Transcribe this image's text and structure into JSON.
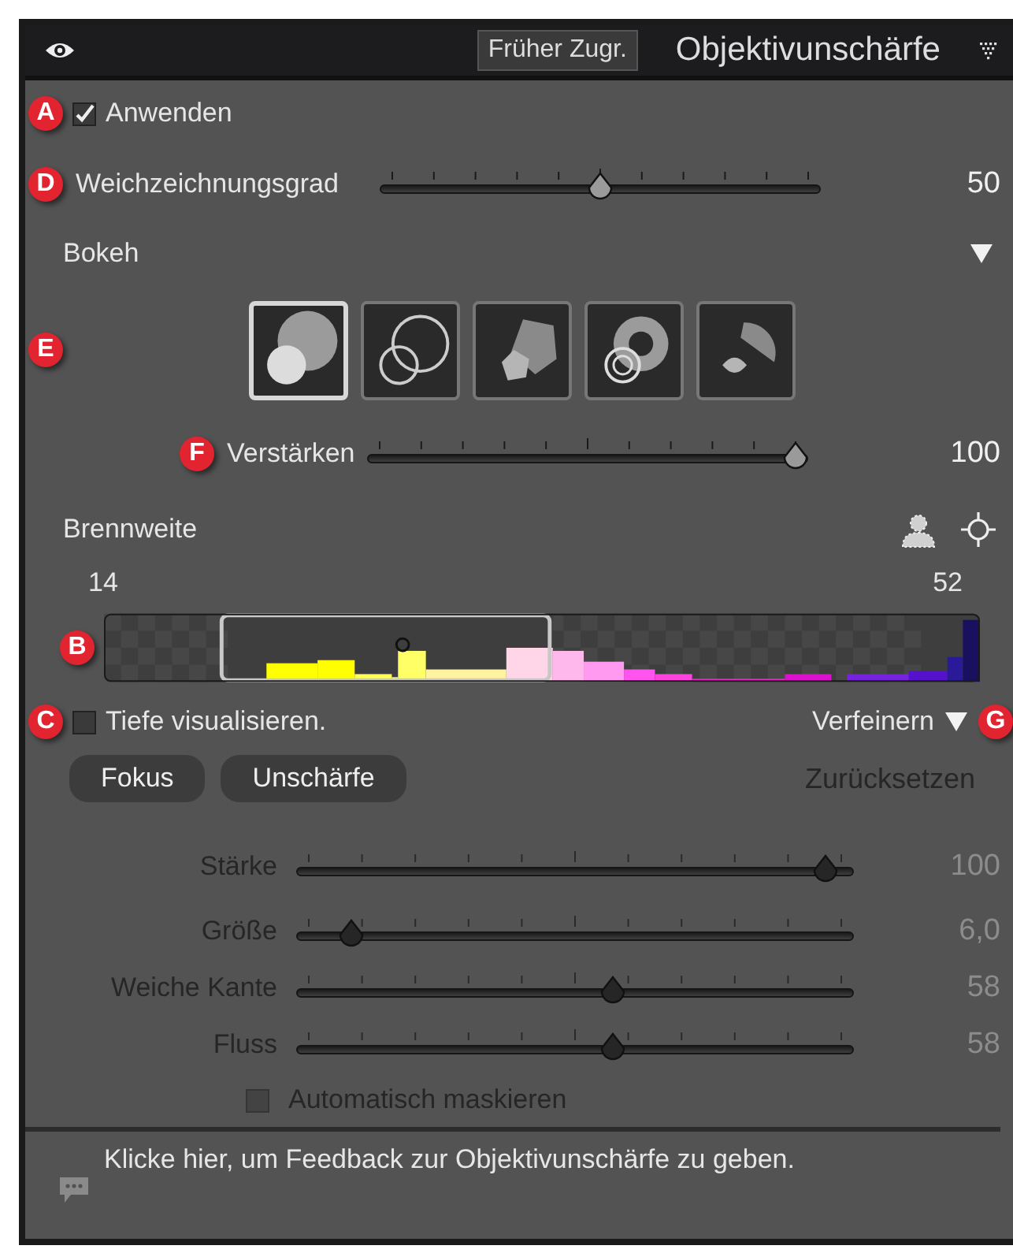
{
  "header": {
    "button": "Früher Zugr.",
    "title": "Objektivunschärfe"
  },
  "apply": {
    "marker": "A",
    "label": "Anwenden",
    "checked": true
  },
  "blur": {
    "marker": "D",
    "label": "Weichzeichnungsgrad",
    "level": 0.5,
    "reading": "50"
  },
  "bokeh": {
    "marker": "E",
    "label": "Bokeh",
    "expanded": true,
    "shapes": [
      {
        "kind": "circle",
        "selected": true
      },
      {
        "kind": "bubble",
        "selected": false
      },
      {
        "kind": "blade",
        "selected": false
      },
      {
        "kind": "ring",
        "selected": false
      },
      {
        "kind": "cateye",
        "selected": false
      }
    ]
  },
  "boost": {
    "marker": "F",
    "label": "Verstärken",
    "level": 1,
    "reading": "100"
  },
  "focal": {
    "marker": "B",
    "label": "Brennweite",
    "min": "14",
    "max": "52"
  },
  "visualize": {
    "marker": "C",
    "label": "Tiefe visualisieren.",
    "checked": false
  },
  "refine": {
    "marker": "G",
    "label": "Verfeinern",
    "expanded": true
  },
  "modes": [
    {
      "label": "Fokus"
    },
    {
      "label": "Unschärfe"
    }
  ],
  "reset": "Zurücksetzen",
  "brush": {
    "disabled": true,
    "sliders": [
      {
        "label": "Stärke",
        "level": 0.97,
        "reading": "100"
      },
      {
        "label": "Größe",
        "level": 0.08,
        "reading": "6,0"
      },
      {
        "label": "Weiche Kante",
        "level": 0.57,
        "reading": "58"
      },
      {
        "label": "Fluss",
        "level": 0.57,
        "reading": "58"
      }
    ],
    "auto_mask": {
      "label": "Automatisch maskieren",
      "checked": false
    }
  },
  "feedback": "Klicke hier, um Feedback zur Objektivunschärfe zu geben."
}
